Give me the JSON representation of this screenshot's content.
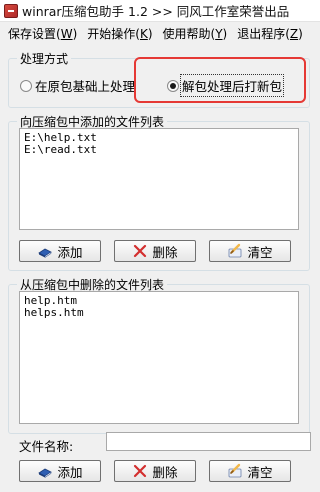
{
  "window": {
    "title": "winrar压缩包助手 1.2   >>  同风工作室荣誉出品"
  },
  "menu": [
    {
      "label": "保存设置(",
      "key": "W",
      "suffix": ")"
    },
    {
      "label": "开始操作(",
      "key": "K",
      "suffix": ")"
    },
    {
      "label": "使用帮助(",
      "key": "Y",
      "suffix": ")"
    },
    {
      "label": "退出程序(",
      "key": "Z",
      "suffix": ")"
    }
  ],
  "mode": {
    "title": "处理方式",
    "option_original": "在原包基础上处理",
    "option_repack": "解包处理后打新包",
    "selected": "repack"
  },
  "add_list": {
    "title": "向压缩包中添加的文件列表",
    "items": [
      "E:\\help.txt",
      "E:\\read.txt"
    ],
    "add_label": "添加",
    "delete_label": "删除",
    "clear_label": "清空"
  },
  "remove_list": {
    "title": "从压缩包中删除的文件列表",
    "items": [
      "help.htm",
      "helps.htm"
    ],
    "add_label": "添加",
    "delete_label": "删除",
    "clear_label": "清空"
  },
  "filename": {
    "label": "文件名称:",
    "value": "",
    "placeholder": ""
  },
  "colors": {
    "highlight": "#e53935",
    "delete_x": "#d32f2f",
    "book_blue": "#2f5fb3"
  }
}
